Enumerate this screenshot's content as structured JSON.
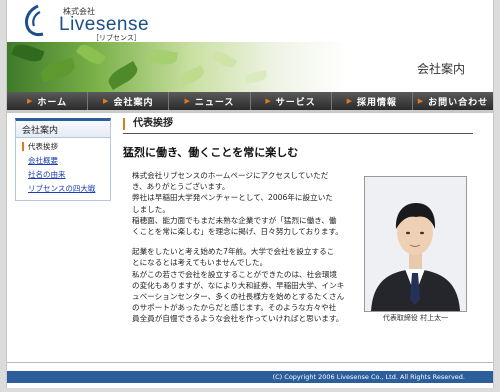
{
  "header": {
    "company_kind": "株式会社",
    "company_name": "Livesense",
    "company_kana": "［リブセンス］"
  },
  "banner": {
    "title": "会社案内"
  },
  "nav": {
    "items": [
      {
        "label": "ホーム"
      },
      {
        "label": "会社案内"
      },
      {
        "label": "ニュース"
      },
      {
        "label": "サービス"
      },
      {
        "label": "採用情報"
      },
      {
        "label": "お問い合わせ"
      }
    ]
  },
  "sidebar": {
    "heading": "会社案内",
    "items": [
      {
        "label": "代表挨拶"
      },
      {
        "label": "会社概要"
      },
      {
        "label": "社名の由来"
      },
      {
        "label": "リブセンスの四大戦"
      }
    ]
  },
  "main": {
    "section_title": "代表挨拶",
    "headline": "猛烈に働き、働くことを常に楽しむ",
    "paragraphs": [
      {
        "lines": [
          "株式会社リブセンスのホームページにアクセスしていただ",
          "き、ありがとうございます。",
          "弊社は早稲田大学発ベンチャーとして、2006年に設立いた",
          "しました。",
          "稲穂面、能力面でもまだ未熟な企業ですが「猛烈に働き、働",
          "くことを常に楽しむ」を理念に掲げ、日々努力しております。"
        ]
      },
      {
        "lines": [
          "起業をしたいと考え始めた7年前。大学で会社を設立するこ",
          "とになるとは考えてもいませんでした。",
          "私がこの若さで会社を設立することができたのは、社会環境",
          "の変化もありますが、なにより大和証券、早稲田大学、インキ",
          "ュベーションセンター、多くの社長様方を始めとするたくさん",
          "のサポートがあったからだと感じます。そのような方々や社",
          "員全員が自慢できるような会社を作っていければと思います。"
        ]
      }
    ],
    "photo_caption": "代表取締役 村上太一"
  },
  "footer": {
    "copyright": "(C) Copyright 2006 Livesense Co., Ltd. All Rights Reserved."
  },
  "colors": {
    "brand_blue": "#2c5e9c",
    "accent_orange": "#e07a1e",
    "nav_dark": "#333333"
  }
}
